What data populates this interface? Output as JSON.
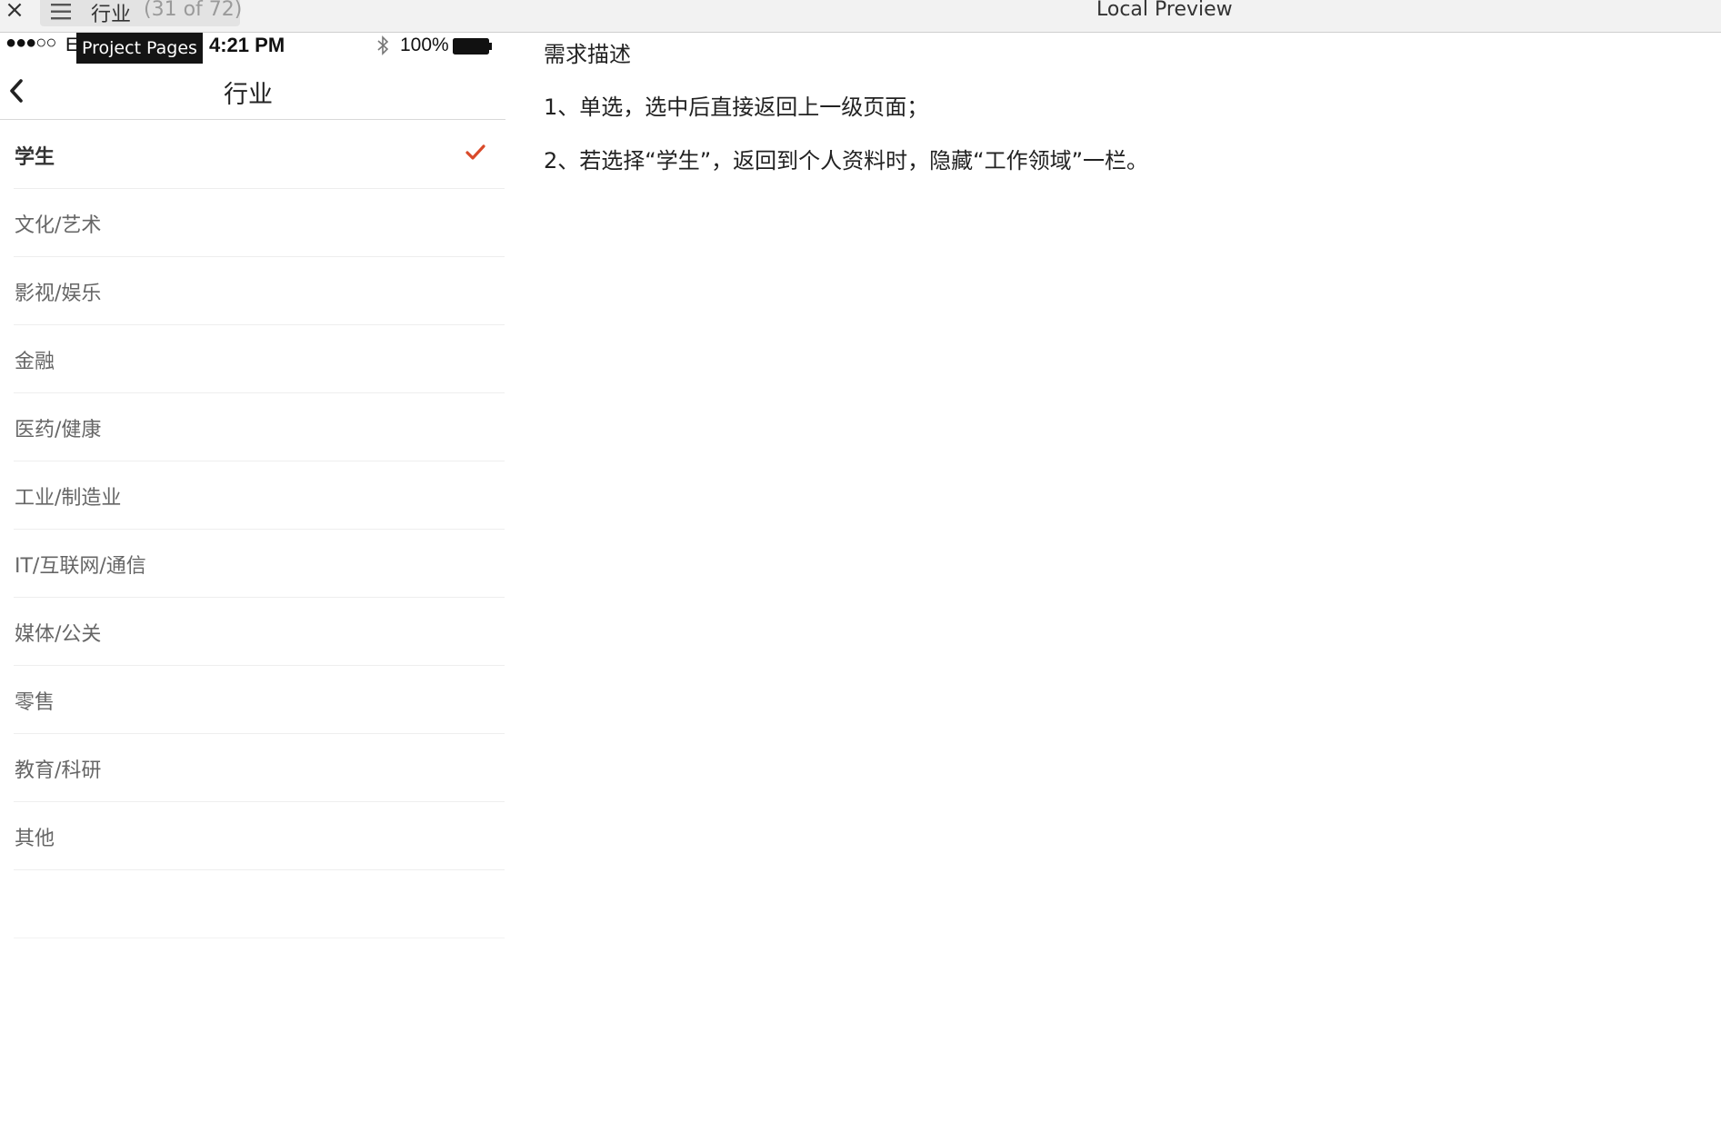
{
  "toolbar": {
    "close_glyph": "×",
    "page_title": "行业",
    "page_count": "(31 of 72)",
    "window_title": "Local Preview",
    "tooltip": "Project Pages"
  },
  "statusbar": {
    "signal": "●●●○○",
    "carrier": "E",
    "time": "4:21 PM",
    "battery": "100%"
  },
  "navbar": {
    "title": "行业"
  },
  "industry_list": {
    "selected_index": 0,
    "items": [
      {
        "label": "学生"
      },
      {
        "label": "文化/艺术"
      },
      {
        "label": "影视/娱乐"
      },
      {
        "label": "金融"
      },
      {
        "label": "医药/健康"
      },
      {
        "label": "工业/制造业"
      },
      {
        "label": "IT/互联网/通信"
      },
      {
        "label": "媒体/公关"
      },
      {
        "label": "零售"
      },
      {
        "label": "教育/科研"
      },
      {
        "label": "其他"
      }
    ]
  },
  "notes": {
    "title": "需求描述",
    "lines": [
      "1、单选，选中后直接返回上一级页面；",
      "2、若选择“学生”，返回到个人资料时，隐藏“工作领域”一栏。"
    ]
  },
  "colors": {
    "accent_check": "#d94a2a",
    "tooltip_bg": "#141414",
    "toolbar_bg": "#f2f2f2"
  }
}
